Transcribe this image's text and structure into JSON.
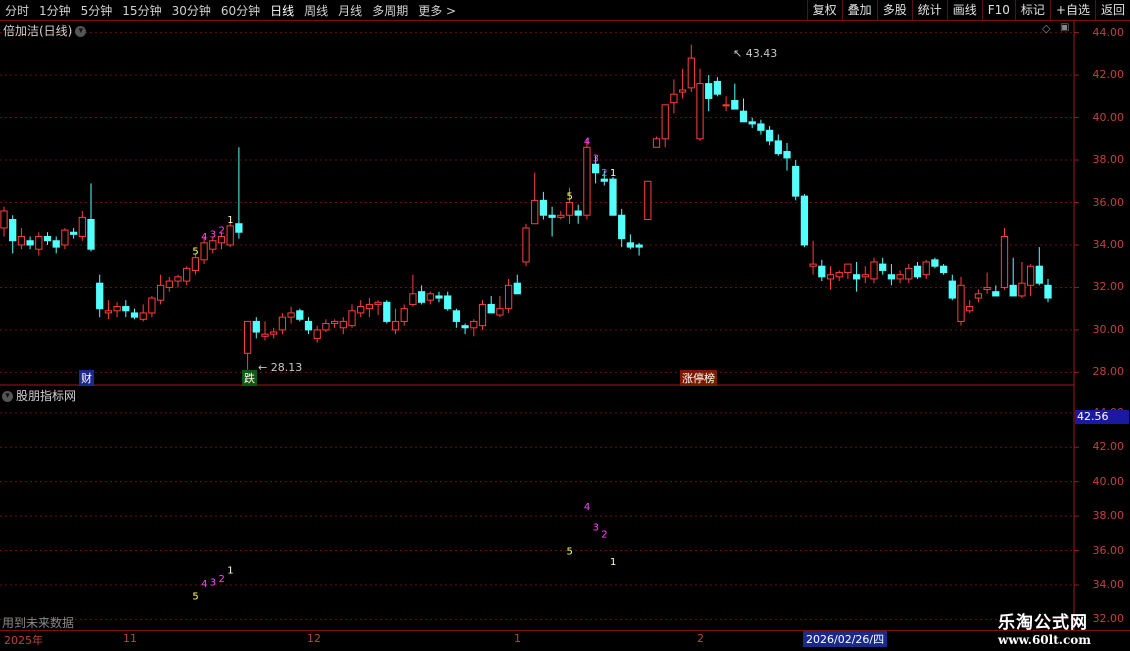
{
  "toolbar": {
    "periods": [
      "分时",
      "1分钟",
      "5分钟",
      "15分钟",
      "30分钟",
      "60分钟",
      "日线",
      "周线",
      "月线",
      "多周期",
      "更多 >"
    ],
    "active_period": "日线",
    "actions": [
      "复权",
      "叠加",
      "多股",
      "统计",
      "画线",
      "F10",
      "标记",
      "+自选",
      "返回"
    ]
  },
  "main_panel": {
    "title": "倍加洁(日线)",
    "high_label": "43.43",
    "low_label": "28.13",
    "y_ticks": [
      "44.00",
      "42.00",
      "40.00",
      "38.00",
      "36.00",
      "34.00",
      "32.00",
      "30.00",
      "28.00"
    ],
    "tags": {
      "cai": "财",
      "die": "跌",
      "zhangting": "涨停榜"
    }
  },
  "sub_panel": {
    "title": "股朋指标网",
    "y_ticks": [
      "44.00",
      "42.00",
      "40.00",
      "38.00",
      "36.00",
      "34.00",
      "32.00"
    ],
    "current_value": "42.56",
    "footer_note": "用到未来数据"
  },
  "timeline": {
    "labels": [
      "2025年",
      "11",
      "12",
      "1",
      "2"
    ],
    "selected_date": "2026/02/26/四"
  },
  "watermark": {
    "title": "乐淘公式网",
    "url": "www.60lt.com"
  },
  "colors": {
    "up": "#ff3d3d",
    "down": "#54ffff",
    "grid": "#6a0f0f",
    "bg": "#000000"
  },
  "chart_data": {
    "type": "candlestick",
    "y_range_main": [
      27.5,
      44.5
    ],
    "candles": [
      [
        34.8,
        35.8,
        34.4,
        35.6
      ],
      [
        35.2,
        35.4,
        33.6,
        34.2
      ],
      [
        34.0,
        34.8,
        33.8,
        34.4
      ],
      [
        34.2,
        34.4,
        33.8,
        34.0
      ],
      [
        33.8,
        34.6,
        33.5,
        34.4
      ],
      [
        34.4,
        34.6,
        34.0,
        34.2
      ],
      [
        34.2,
        34.4,
        33.6,
        33.9
      ],
      [
        34.0,
        34.8,
        33.8,
        34.7
      ],
      [
        34.6,
        34.8,
        34.3,
        34.5
      ],
      [
        34.4,
        35.6,
        34.2,
        35.3
      ],
      [
        35.2,
        36.9,
        33.7,
        33.8
      ],
      [
        32.2,
        32.6,
        30.6,
        31.0
      ],
      [
        30.8,
        31.4,
        30.5,
        30.9
      ],
      [
        30.9,
        31.3,
        30.6,
        31.1
      ],
      [
        31.1,
        31.4,
        30.6,
        30.9
      ],
      [
        30.8,
        31.0,
        30.5,
        30.6
      ],
      [
        30.5,
        31.2,
        30.4,
        30.8
      ],
      [
        30.8,
        31.6,
        30.6,
        31.5
      ],
      [
        31.4,
        32.6,
        31.2,
        32.1
      ],
      [
        32.0,
        32.5,
        31.8,
        32.3
      ],
      [
        32.3,
        32.6,
        32.0,
        32.5
      ],
      [
        32.3,
        33.0,
        32.1,
        32.9
      ],
      [
        32.8,
        33.6,
        32.6,
        33.4
      ],
      [
        33.3,
        34.4,
        33.1,
        34.1
      ],
      [
        33.8,
        34.4,
        33.6,
        34.2
      ],
      [
        34.1,
        34.6,
        33.8,
        34.4
      ],
      [
        34.0,
        35.1,
        33.9,
        34.9
      ],
      [
        35.0,
        38.6,
        34.3,
        34.6
      ],
      [
        28.9,
        29.8,
        28.13,
        30.4
      ],
      [
        30.4,
        30.6,
        29.6,
        29.9
      ],
      [
        29.7,
        30.4,
        29.5,
        29.8
      ],
      [
        29.8,
        30.1,
        29.6,
        29.9
      ],
      [
        30.0,
        30.8,
        29.8,
        30.6
      ],
      [
        30.6,
        31.1,
        30.3,
        30.8
      ],
      [
        30.9,
        31.0,
        30.4,
        30.5
      ],
      [
        30.4,
        30.6,
        29.8,
        30.0
      ],
      [
        29.6,
        30.2,
        29.4,
        30.0
      ],
      [
        30.0,
        30.5,
        29.9,
        30.3
      ],
      [
        30.3,
        30.5,
        30.1,
        30.4
      ],
      [
        30.1,
        30.6,
        29.8,
        30.4
      ],
      [
        30.2,
        31.2,
        30.1,
        30.9
      ],
      [
        30.8,
        31.4,
        30.6,
        31.1
      ],
      [
        31.0,
        31.5,
        30.6,
        31.2
      ],
      [
        31.2,
        31.4,
        30.7,
        31.3
      ],
      [
        31.3,
        31.4,
        30.3,
        30.4
      ],
      [
        30.0,
        31.0,
        29.8,
        30.4
      ],
      [
        30.4,
        31.2,
        30.2,
        31.0
      ],
      [
        31.2,
        32.6,
        31.1,
        31.7
      ],
      [
        31.8,
        32.1,
        31.2,
        31.3
      ],
      [
        31.4,
        31.8,
        31.2,
        31.7
      ],
      [
        31.6,
        31.8,
        31.3,
        31.5
      ],
      [
        31.6,
        31.8,
        30.9,
        31.0
      ],
      [
        30.9,
        31.0,
        30.1,
        30.4
      ],
      [
        30.2,
        30.3,
        29.8,
        30.1
      ],
      [
        30.1,
        30.5,
        29.7,
        30.4
      ],
      [
        30.2,
        31.4,
        30.0,
        31.2
      ],
      [
        31.2,
        31.6,
        30.8,
        30.8
      ],
      [
        30.7,
        31.6,
        30.6,
        31.0
      ],
      [
        31.0,
        32.4,
        30.8,
        32.1
      ],
      [
        32.2,
        32.6,
        31.7,
        31.7
      ],
      [
        33.2,
        35.0,
        33.0,
        34.8
      ],
      [
        35.0,
        37.4,
        35.0,
        36.1
      ],
      [
        36.1,
        36.5,
        35.2,
        35.4
      ],
      [
        35.4,
        35.8,
        34.4,
        35.3
      ],
      [
        35.3,
        35.6,
        35.2,
        35.4
      ],
      [
        35.4,
        36.7,
        35.0,
        36.0
      ],
      [
        35.6,
        35.9,
        35.0,
        35.4
      ],
      [
        35.4,
        39.0,
        35.2,
        38.6
      ],
      [
        37.8,
        38.2,
        36.9,
        37.4
      ],
      [
        37.1,
        37.5,
        36.8,
        37.0
      ],
      [
        37.1,
        37.2,
        35.4,
        35.4
      ],
      [
        35.4,
        35.7,
        33.9,
        34.3
      ],
      [
        34.1,
        34.5,
        33.8,
        33.9
      ],
      [
        34.0,
        34.1,
        33.5,
        33.9
      ],
      [
        35.2,
        37.0,
        35.2,
        37.0
      ],
      [
        38.6,
        39.1,
        38.6,
        39.0
      ],
      [
        39.0,
        40.5,
        38.6,
        40.6
      ],
      [
        40.7,
        41.8,
        40.2,
        41.1
      ],
      [
        41.2,
        42.3,
        40.9,
        41.3
      ],
      [
        41.4,
        43.43,
        41.2,
        42.8
      ],
      [
        39.0,
        42.3,
        38.9,
        41.6
      ],
      [
        41.6,
        42.0,
        40.3,
        40.9
      ],
      [
        41.7,
        41.9,
        41.0,
        41.1
      ],
      [
        40.6,
        41.0,
        40.3,
        40.6
      ],
      [
        40.8,
        41.6,
        40.7,
        40.4
      ],
      [
        40.3,
        40.9,
        40.1,
        39.8
      ],
      [
        39.8,
        40.0,
        39.5,
        39.7
      ],
      [
        39.7,
        39.9,
        39.2,
        39.4
      ],
      [
        39.4,
        39.6,
        38.7,
        38.9
      ],
      [
        38.9,
        39.2,
        38.2,
        38.3
      ],
      [
        38.4,
        38.8,
        37.5,
        38.1
      ],
      [
        37.7,
        38.0,
        36.1,
        36.3
      ],
      [
        36.3,
        36.4,
        33.9,
        34.0
      ],
      [
        33.0,
        34.2,
        32.6,
        33.1
      ],
      [
        33.0,
        33.3,
        32.3,
        32.5
      ],
      [
        32.4,
        33.0,
        31.9,
        32.6
      ],
      [
        32.5,
        32.8,
        32.3,
        32.7
      ],
      [
        32.7,
        33.1,
        32.4,
        33.1
      ],
      [
        32.6,
        33.2,
        31.8,
        32.4
      ],
      [
        32.5,
        33.0,
        32.2,
        32.6
      ],
      [
        32.4,
        33.4,
        32.2,
        33.2
      ],
      [
        33.1,
        33.4,
        32.6,
        32.8
      ],
      [
        32.6,
        33.1,
        32.1,
        32.4
      ],
      [
        32.4,
        32.8,
        32.2,
        32.6
      ],
      [
        32.4,
        33.1,
        32.2,
        32.9
      ],
      [
        33.0,
        33.2,
        32.4,
        32.5
      ],
      [
        32.6,
        33.3,
        32.4,
        33.2
      ],
      [
        33.3,
        33.4,
        32.9,
        33.0
      ],
      [
        33.0,
        33.1,
        32.6,
        32.7
      ],
      [
        32.3,
        32.6,
        31.4,
        31.5
      ],
      [
        30.4,
        32.5,
        30.2,
        32.1
      ],
      [
        30.9,
        31.4,
        30.8,
        31.1
      ],
      [
        31.5,
        31.9,
        31.3,
        31.7
      ],
      [
        31.9,
        32.7,
        31.7,
        32.0
      ],
      [
        31.8,
        32.1,
        31.7,
        31.6
      ],
      [
        32.0,
        34.8,
        31.9,
        34.4
      ],
      [
        32.1,
        33.4,
        32.0,
        31.6
      ],
      [
        31.6,
        33.2,
        31.5,
        32.2
      ],
      [
        32.1,
        33.1,
        31.6,
        33.0
      ],
      [
        33.0,
        33.9,
        32.1,
        32.2
      ],
      [
        32.1,
        32.4,
        31.3,
        31.5
      ]
    ],
    "signals": [
      {
        "candle": 22,
        "label": "5",
        "color": "#ffff66"
      },
      {
        "candle": 23,
        "label": "4",
        "color": "#ff44ff"
      },
      {
        "candle": 24,
        "label": "3",
        "color": "#ff44ff"
      },
      {
        "candle": 25,
        "label": "2",
        "color": "#ff44ff"
      },
      {
        "candle": 26,
        "label": "1",
        "color": "#ffffcc"
      },
      {
        "candle": 65,
        "label": "5",
        "color": "#ffff66"
      },
      {
        "candle": 67,
        "label": "4",
        "color": "#ff44ff"
      },
      {
        "candle": 68,
        "label": "3",
        "color": "#ff44ff"
      },
      {
        "candle": 69,
        "label": "2",
        "color": "#ff44ff"
      },
      {
        "candle": 70,
        "label": "1",
        "color": "#ffffcc"
      }
    ]
  }
}
